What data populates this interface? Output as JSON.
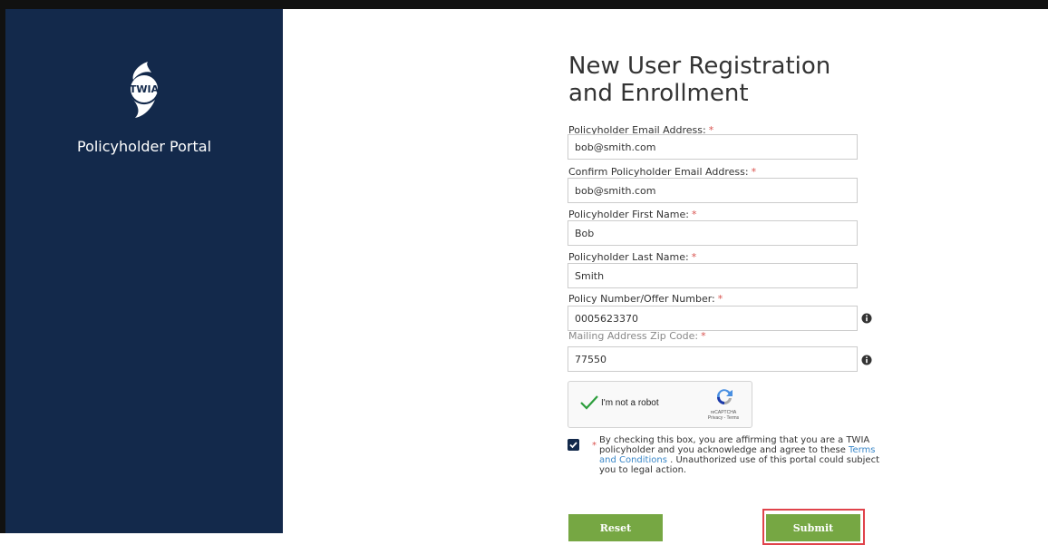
{
  "sidebar": {
    "logo_text": "TWIA",
    "portal_title": "Policyholder Portal"
  },
  "form": {
    "heading_line1": "New User Registration",
    "heading_line2": "and Enrollment",
    "required_marker": "*",
    "fields": [
      {
        "label": "Policyholder Email Address:",
        "value": "bob@smith.com"
      },
      {
        "label": "Confirm Policyholder Email Address:",
        "value": "bob@smith.com"
      },
      {
        "label": "Policyholder First Name:",
        "value": "Bob"
      },
      {
        "label": "Policyholder Last Name:",
        "value": "Smith"
      },
      {
        "label": "Policy Number/Offer Number:",
        "value": "0005623370"
      },
      {
        "label": "Mailing Address Zip Code:",
        "value": "77550"
      }
    ],
    "captcha": {
      "label": "I'm not a robot",
      "brand": "reCAPTCHA",
      "links": "Privacy - Terms",
      "checked": true
    },
    "agreement": {
      "checked": true,
      "text_before": "By checking this box, you are affirming that you are a TWIA policyholder and you acknowledge and agree to these ",
      "link_text": "Terms and Conditions",
      "text_after": " . Unauthorized use of this portal could subject you to legal action."
    },
    "buttons": {
      "reset": "Reset",
      "submit": "Submit"
    }
  },
  "colors": {
    "sidebar_bg": "#13294b",
    "button_green": "#76a743",
    "required_red": "#d9534f",
    "link_blue": "#3a87c8",
    "highlight_red": "#e0434b"
  }
}
